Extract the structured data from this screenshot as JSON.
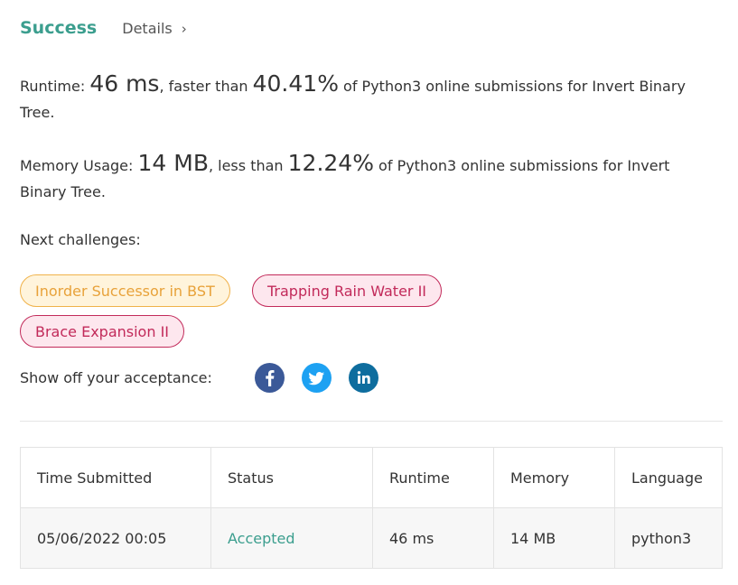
{
  "header": {
    "status_title": "Success",
    "details_label": "Details",
    "details_chevron": "›"
  },
  "runtime_stat": {
    "prefix": "Runtime: ",
    "value": "46 ms",
    "middle": ", faster than ",
    "percent": "40.41%",
    "suffix": " of Python3 online submissions for Invert Binary Tree."
  },
  "memory_stat": {
    "prefix": "Memory Usage: ",
    "value": "14 MB",
    "middle": ", less than ",
    "percent": "12.24%",
    "suffix": " of Python3 online submissions for Invert Binary Tree."
  },
  "next_challenges": {
    "label": "Next challenges:",
    "items": [
      {
        "label": "Inorder Successor in BST",
        "difficulty": "medium"
      },
      {
        "label": "Trapping Rain Water II",
        "difficulty": "hard"
      },
      {
        "label": "Brace Expansion II",
        "difficulty": "hard"
      }
    ]
  },
  "share": {
    "label": "Show off your acceptance:",
    "icons": [
      "facebook-icon",
      "twitter-icon",
      "linkedin-icon"
    ]
  },
  "submissions_table": {
    "headers": [
      "Time Submitted",
      "Status",
      "Runtime",
      "Memory",
      "Language"
    ],
    "rows": [
      [
        "05/06/2022 00:05",
        "Accepted",
        "46 ms",
        "14 MB",
        "python3"
      ]
    ]
  },
  "colors": {
    "accent_green": "#3b9e8e",
    "medium_border": "#f0b24a",
    "hard_border": "#c22a5a",
    "facebook": "#3b5998",
    "twitter": "#1da1f2",
    "linkedin": "#0e6d9e"
  }
}
